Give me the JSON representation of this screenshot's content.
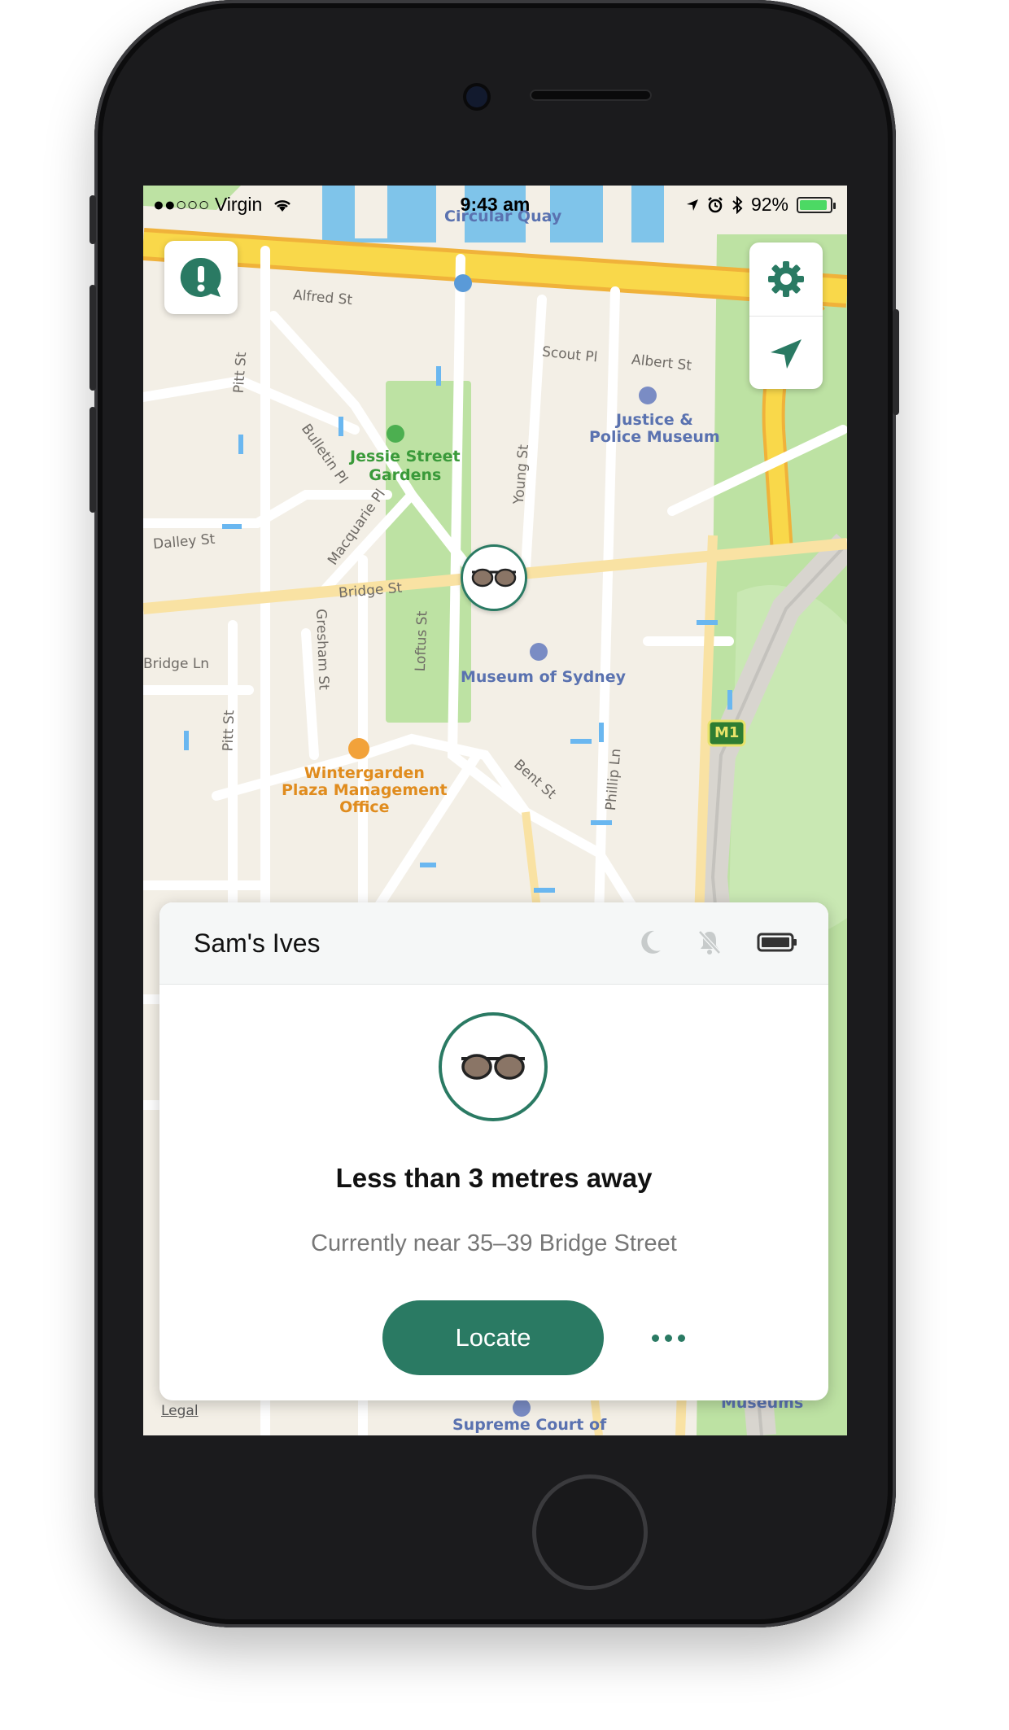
{
  "status_bar": {
    "carrier": "●●○○○ Virgin",
    "time": "9:43 am",
    "battery": "92%",
    "battery_level": 0.92
  },
  "map": {
    "streets": [
      "Alfred St",
      "Scout Pl",
      "Albert St",
      "Pitt St",
      "Bulletin Pl",
      "Young St",
      "Macquarie Pl",
      "Dalley St",
      "Bridge St",
      "Gresham St",
      "Loftus St",
      "Bridge Ln",
      "Pitt St",
      "Bent St",
      "Phillip Ln",
      "M1"
    ],
    "pois": {
      "circular_quay": "Circular Quay",
      "justice_line1": "Justice &",
      "justice_line2": "Police Museum",
      "jessie_line1": "Jessie Street",
      "jessie_line2": "Gardens",
      "museum_sydney": "Museum of Sydney",
      "wintergarden_line1": "Wintergarden",
      "wintergarden_line2": "Plaza Management",
      "wintergarden_line3": "Office",
      "supreme_court": "Supreme Court of",
      "museums": "Museums"
    },
    "legal": "Legal",
    "colors": {
      "land": "#f3efe6",
      "road": "#ffffff",
      "highway": "#f9d84a",
      "park": "#bde2a3",
      "water": "#7fc4ea",
      "accent": "#2a7a63"
    }
  },
  "controls": {
    "alert_icon": "exclamation-bubble-icon",
    "settings_icon": "gear-icon",
    "location_icon": "location-arrow-icon"
  },
  "card": {
    "title": "Sam's Ives",
    "status_icons": [
      "moon-icon",
      "bell-off-icon",
      "battery-icon"
    ],
    "distance": "Less than 3 metres away",
    "near": "Currently near 35–39 Bridge Street",
    "locate_label": "Locate"
  }
}
